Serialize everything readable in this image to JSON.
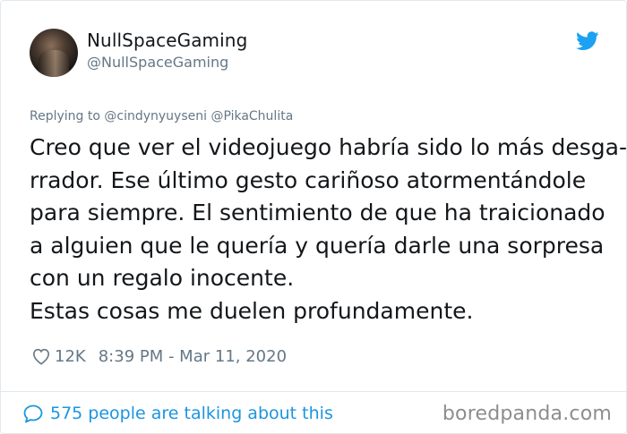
{
  "author": {
    "display_name": "NullSpaceGaming",
    "handle": "@NullSpaceGaming"
  },
  "reply_line": "Replying to @cindynyuyseni @PikaChulita",
  "tweet_lines": [
    "Creo que ver el videojuego habría sido lo más desga-",
    "rrador. Ese último gesto cariñoso atormentándole",
    "para siempre. El sentimiento de que ha traicionado",
    "a alguien que le quería y quería darle una sorpresa",
    "con un regalo inocente.",
    "Estas cosas me duelen profundamente."
  ],
  "meta": {
    "likes": "12K",
    "timestamp": "8:39 PM - Mar 11, 2020"
  },
  "conversation_link": "575 people are talking about this",
  "watermark": "boredpanda.com",
  "icons": {
    "logo": "twitter-bird-icon",
    "like": "heart-icon",
    "conversation": "speech-bubble-icon"
  },
  "colors": {
    "twitter_blue": "#1da1f2",
    "link_blue": "#1b95e0",
    "text": "#14171a",
    "muted": "#657786"
  }
}
